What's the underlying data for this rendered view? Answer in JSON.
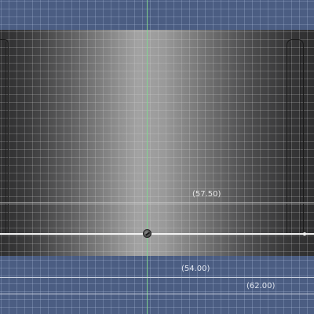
{
  "viewport": {
    "background_color": "#4b5d82",
    "part_shading": [
      "#2f2f30",
      "#a3a3a3",
      "#2e2e2f"
    ],
    "axis_color": "#7fd98f"
  },
  "dimensions": {
    "upper_label": "(57.50)",
    "middle_label": "(54.00)",
    "lower_label": "(62.00)"
  },
  "markers": {
    "origin_icon": "origin-marker-icon"
  }
}
